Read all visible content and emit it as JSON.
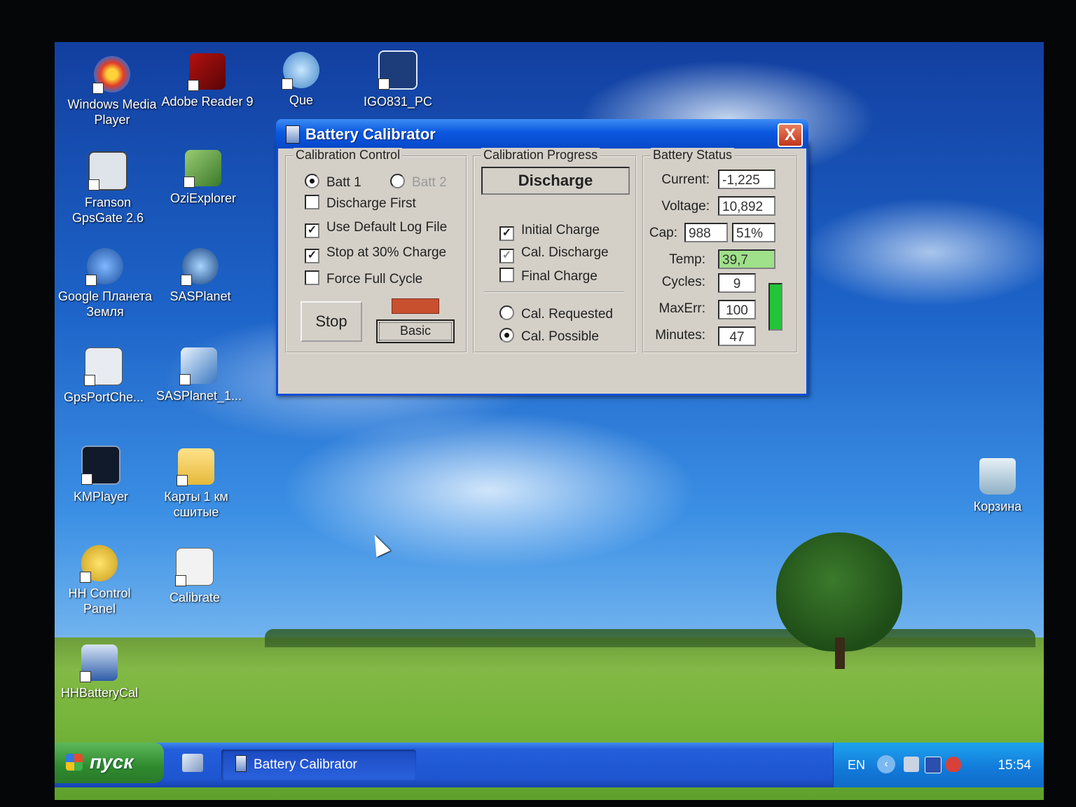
{
  "desktop": {
    "icons": [
      {
        "label": "Windows Media Player",
        "icon": "media-player-icon"
      },
      {
        "label": "Adobe Reader 9",
        "icon": "adobe-reader-icon"
      },
      {
        "label": "Que",
        "icon": "que-icon"
      },
      {
        "label": "IGO831_PC",
        "icon": "igo-icon"
      },
      {
        "label": "Franson GpsGate 2.6",
        "icon": "gpsgate-icon"
      },
      {
        "label": "OziExplorer",
        "icon": "ozi-explorer-icon"
      },
      {
        "label": "Google Планета Земля",
        "icon": "google-earth-icon"
      },
      {
        "label": "SASPlanet",
        "icon": "sasplanet-icon"
      },
      {
        "label": "GpsPortChe...",
        "icon": "gps-port-icon"
      },
      {
        "label": "SASPlanet_1...",
        "icon": "sasplanet-shortcut-icon"
      },
      {
        "label": "KMPlayer",
        "icon": "kmplayer-icon"
      },
      {
        "label": "Карты 1 км сшитые",
        "icon": "folder-icon"
      },
      {
        "label": "HH Control Panel",
        "icon": "control-panel-icon"
      },
      {
        "label": "Calibrate",
        "icon": "document-icon"
      },
      {
        "label": "HHBatteryCal",
        "icon": "battery-icon"
      },
      {
        "label": "Корзина",
        "icon": "recycle-bin-icon"
      }
    ]
  },
  "window": {
    "title": "Battery Calibrator",
    "close_label": "X",
    "calibration_control": {
      "legend": "Calibration Control",
      "batt1": "Batt 1",
      "batt2": "Batt 2",
      "discharge_first": "Discharge First",
      "use_default_log": "Use Default Log File",
      "stop_at_30": "Stop at 30% Charge",
      "force_full_cycle": "Force Full Cycle",
      "stop_button": "Stop",
      "basic_button": "Basic",
      "indicator_color": "#c9502f"
    },
    "calibration_progress": {
      "legend": "Calibration Progress",
      "status": "Discharge",
      "initial_charge": "Initial Charge",
      "cal_discharge": "Cal. Discharge",
      "final_charge": "Final Charge",
      "cal_requested": "Cal. Requested",
      "cal_possible": "Cal. Possible"
    },
    "battery_status": {
      "legend": "Battery Status",
      "current_label": "Current:",
      "current_value": "-1,225",
      "voltage_label": "Voltage:",
      "voltage_value": "10,892",
      "cap_label": "Cap:",
      "cap_value": "988",
      "cap_percent": "51%",
      "temp_label": "Temp:",
      "temp_value": "39,7",
      "cycles_label": "Cycles:",
      "cycles_value": "9",
      "maxerr_label": "MaxErr:",
      "maxerr_value": "100",
      "minutes_label": "Minutes:",
      "minutes_value": "47",
      "temp_color": "#9fe08a",
      "bar_color": "#22c43a"
    }
  },
  "taskbar": {
    "start_label": "пуск",
    "task_label": "Battery Calibrator",
    "language": "EN",
    "clock": "15:54"
  }
}
